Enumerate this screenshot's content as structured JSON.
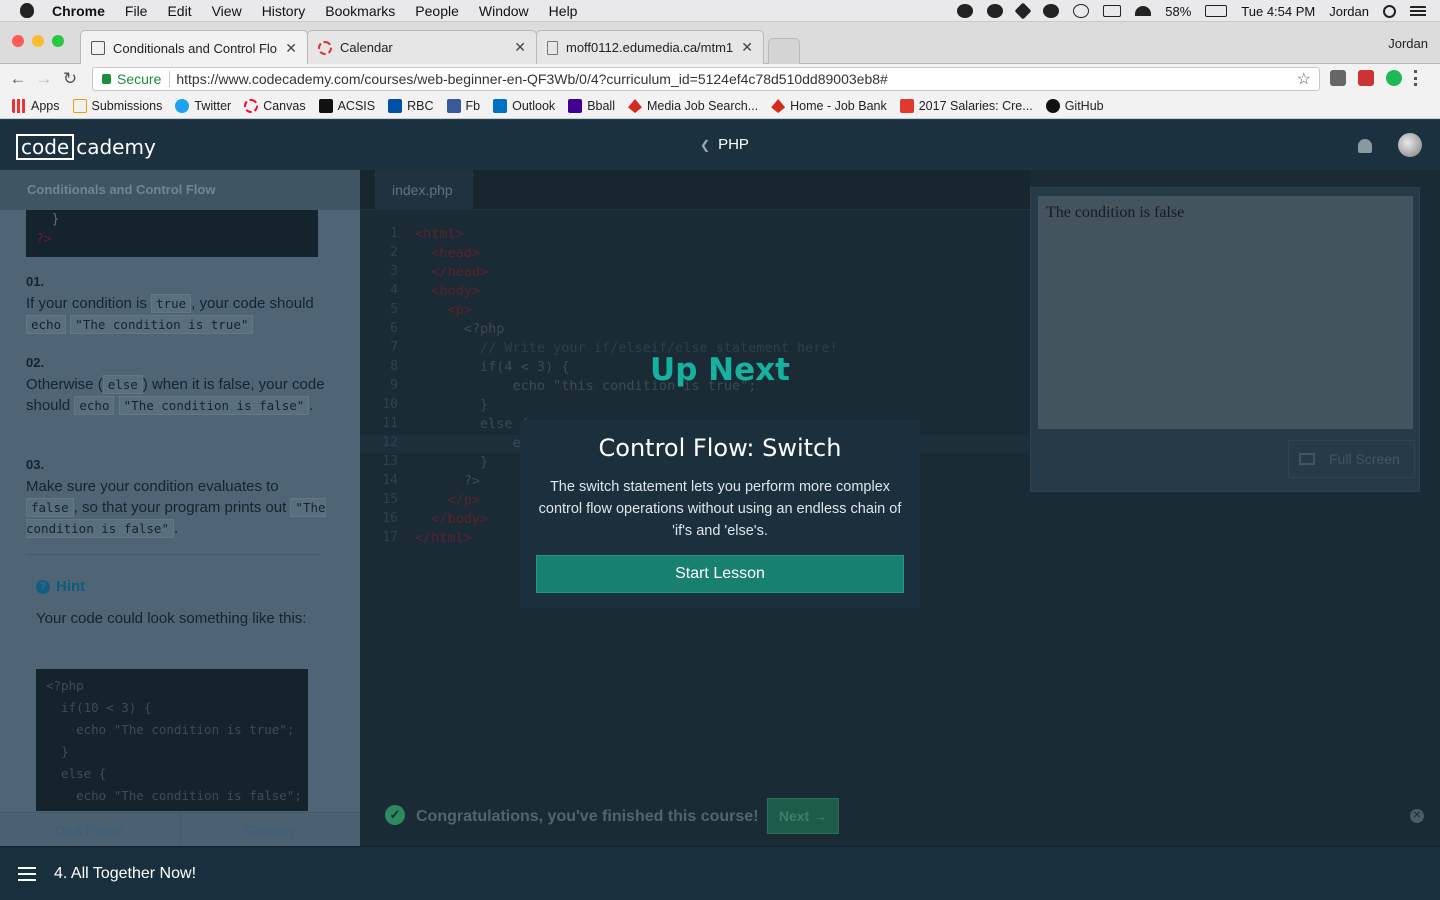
{
  "menubar": {
    "app": "Chrome",
    "items": [
      "File",
      "Edit",
      "View",
      "History",
      "Bookmarks",
      "People",
      "Window",
      "Help"
    ],
    "battery": "58%",
    "clock": "Tue 4:54 PM",
    "user": "Jordan"
  },
  "tabs": [
    {
      "title": "Conditionals and Control Flow"
    },
    {
      "title": "Calendar"
    },
    {
      "title": "moff0112.edumedia.ca/mtm1"
    }
  ],
  "profile_name": "Jordan",
  "address": {
    "secure_label": "Secure",
    "url": "https://www.codecademy.com/courses/web-beginner-en-QF3Wb/0/4?curriculum_id=5124ef4c78d510dd89003eb8#"
  },
  "bookmarks": [
    "Apps",
    "Submissions",
    "Twitter",
    "Canvas",
    "ACSIS",
    "RBC",
    "Fb",
    "Outlook",
    "Bball",
    "Media Job Search...",
    "Home - Job Bank",
    "2017 Salaries: Cre...",
    "GitHub"
  ],
  "app": {
    "logo_box": "code",
    "logo_rest": "cademy",
    "course": "PHP"
  },
  "lesson": {
    "title": "Conditionals and Control Flow",
    "code_top": [
      "  }",
      "?>"
    ],
    "steps": [
      {
        "num": "01.",
        "pre": "If your condition is ",
        "c1": "true",
        "mid": ", your code should ",
        "c2": "echo",
        "c3": "\"The condition is true\""
      },
      {
        "num": "02.",
        "pre": "Otherwise (",
        "c1": "else",
        "mid": ") when it is false, your code should ",
        "c2": "echo",
        "c3": "\"The condition is false\"",
        "post": "."
      },
      {
        "num": "03.",
        "pre": "Make sure your condition evaluates to ",
        "c1": "false",
        "mid": ", so that your program prints out ",
        "c3": "\"The condition is false\"",
        "post": "."
      }
    ],
    "hint_label": "Hint",
    "hint_text": "Your code could look something like this:",
    "hint_code": "<?php\n  if(10 < 3) {\n    echo \"The condition is true\";\n  }\n  else {\n    echo \"The condition is false\";",
    "footer_left": "Q&A Forum",
    "footer_right": "Glossary"
  },
  "editor": {
    "file_tab": "index.php",
    "lines": [
      "<html>",
      "  <head>",
      "  </head>",
      "  <body>",
      "    <p>",
      "      <?php",
      "        // Write your if/elseif/else statement here!",
      "        if(4 < 3) {",
      "            echo \"this condition is true\";",
      "        }",
      "        else {",
      "            echo",
      "        }",
      "      ?>",
      "    </p>",
      "  </body>",
      "</html>"
    ]
  },
  "output": {
    "text": "The condition is false",
    "fullscreen": "Full Screen"
  },
  "success": {
    "message": "Congratulations, you've finished this course!",
    "next": "Next →"
  },
  "bottom_nav": {
    "label": "4. All Together Now!"
  },
  "modal": {
    "up_next": "Up Next",
    "title": "Control Flow: Switch",
    "description": "The switch statement lets you perform more complex control flow operations without using an endless chain of 'if's and 'else's.",
    "button": "Start Lesson"
  },
  "colors": {
    "accent": "#17806f",
    "header_bg": "#1b3140",
    "editor_bg": "#1a2b35"
  }
}
